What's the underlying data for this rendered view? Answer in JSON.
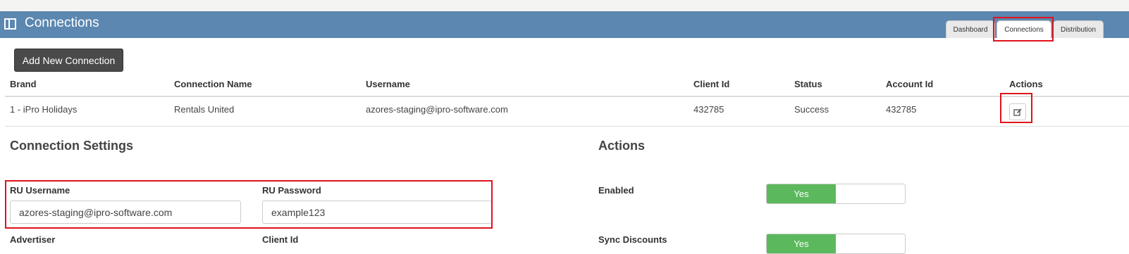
{
  "header": {
    "title": "Connections"
  },
  "tabs": [
    {
      "label": "Dashboard",
      "active": false
    },
    {
      "label": "Connections",
      "active": true
    },
    {
      "label": "Distribution",
      "active": false
    }
  ],
  "toolbar": {
    "add_label": "Add New Connection"
  },
  "table": {
    "columns": [
      "Brand",
      "Connection Name",
      "Username",
      "Client Id",
      "Status",
      "Account Id",
      "Actions"
    ],
    "rows": [
      [
        "1 - iPro Holidays",
        "Rentals United",
        "azores-staging@ipro-software.com",
        "432785",
        "Success",
        "432785"
      ]
    ]
  },
  "settings": {
    "title": "Connection Settings",
    "ru_username_label": "RU Username",
    "ru_username_value": "azores-staging@ipro-software.com",
    "ru_password_label": "RU Password",
    "ru_password_value": "example123",
    "advertiser_label": "Advertiser",
    "client_id_label": "Client Id"
  },
  "actions_panel": {
    "title": "Actions",
    "enabled_label": "Enabled",
    "enabled_value": "Yes",
    "sync_discounts_label": "Sync Discounts",
    "sync_discounts_value": "Yes"
  },
  "colors": {
    "header": "#5b87b0",
    "highlight": "#e0121c",
    "toggle_on": "#5cb85c",
    "button_dark": "#4a4a4a"
  },
  "icons": {
    "header": "panel-icon",
    "edit": "edit-icon"
  }
}
